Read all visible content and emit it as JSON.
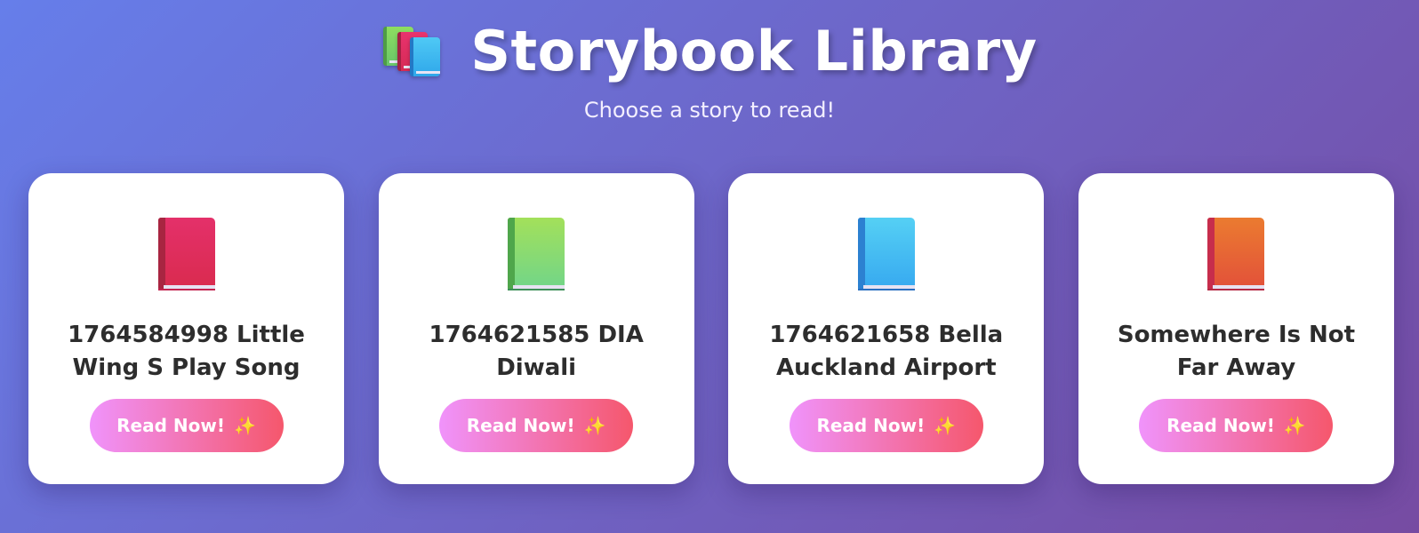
{
  "header": {
    "title": "Storybook Library",
    "subtitle": "Choose a story to read!",
    "logo_icon": "books-icon"
  },
  "stories": [
    {
      "title": "1764584998 Little Wing S Play Song",
      "button_label": "Read Now!",
      "button_icon": "✨",
      "book_icon": "closed-book-icon",
      "book_color": "#e02f62"
    },
    {
      "title": "1764621585 DIA Diwali",
      "button_label": "Read Now!",
      "button_icon": "✨",
      "book_icon": "green-book-icon",
      "book_color": "#8ddd6a"
    },
    {
      "title": "1764621658 Bella Auckland Airport",
      "button_label": "Read Now!",
      "button_icon": "✨",
      "book_icon": "blue-book-icon",
      "book_color": "#43b9f2"
    },
    {
      "title": "Somewhere Is Not Far Away",
      "button_label": "Read Now!",
      "button_icon": "✨",
      "book_icon": "orange-book-icon",
      "book_color": "#e76535"
    }
  ],
  "theme": {
    "background_start": "#667eea",
    "background_end": "#764ba2",
    "button_start": "#f093fb",
    "button_end": "#f5576c",
    "card_background": "#ffffff",
    "title_text": "#2d2d2d"
  }
}
